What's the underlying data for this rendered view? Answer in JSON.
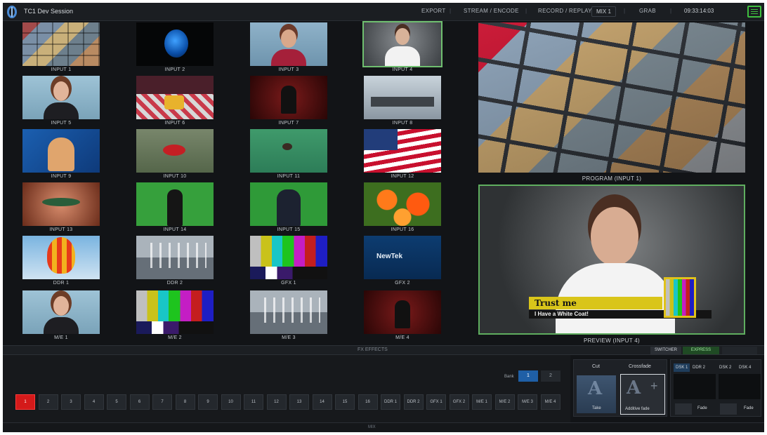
{
  "titlebar": {
    "session_name": "TC1 Dev Session",
    "menu": [
      "EXPORT",
      "STREAM / ENCODE",
      "RECORD / REPLAY",
      "GRAB"
    ],
    "mix_label": "MIX 1",
    "time": "09:33:14:03"
  },
  "inputs": [
    {
      "label": "INPUT 1"
    },
    {
      "label": "INPUT 2"
    },
    {
      "label": "INPUT 3"
    },
    {
      "label": "INPUT 4"
    },
    {
      "label": "INPUT 5"
    },
    {
      "label": "INPUT 6"
    },
    {
      "label": "INPUT 7"
    },
    {
      "label": "INPUT 8"
    },
    {
      "label": "INPUT 9"
    },
    {
      "label": "INPUT 10"
    },
    {
      "label": "INPUT 11"
    },
    {
      "label": "INPUT 12"
    },
    {
      "label": "INPUT 13"
    },
    {
      "label": "INPUT 14"
    },
    {
      "label": "INPUT 15"
    },
    {
      "label": "INPUT 16"
    },
    {
      "label": "DDR 1"
    },
    {
      "label": "DDR 2"
    },
    {
      "label": "GFX 1"
    },
    {
      "label": "GFX 2"
    },
    {
      "label": "M/E 1"
    },
    {
      "label": "M/E 2"
    },
    {
      "label": "M/E 3"
    },
    {
      "label": "M/E 4"
    }
  ],
  "gfx2_logo_text": "NewTek",
  "program": {
    "label": "PROGRAM (INPUT 1)"
  },
  "preview": {
    "label": "PREVIEW (INPUT 4)",
    "lower_third_title": "Trust me",
    "lower_third_subtitle": "I Have a White Coat!"
  },
  "effects": {
    "title": "FX EFFECTS",
    "switch_label": "SWITCHER",
    "express_label": "EXPRESS"
  },
  "switcher": {
    "bank_label": "Bank",
    "banks": [
      "1",
      "2"
    ],
    "buttons": [
      "1",
      "2",
      "3",
      "4",
      "5",
      "6",
      "7",
      "8",
      "9",
      "10",
      "11",
      "12",
      "13",
      "14",
      "15",
      "16",
      "DDR 1",
      "DDR 2",
      "GFX 1",
      "GFX 2",
      "M/E 1",
      "M/E 2",
      "M/E 3",
      "M/E 4"
    ],
    "active_index": 0
  },
  "transition": {
    "cut_label": "Cut",
    "crossfade_label": "Crossfade",
    "take_label": "Take",
    "auto_label": "Additive fade"
  },
  "dsk": {
    "tabs": [
      "DSK 1",
      "DDR 2",
      "DSK 2",
      "DSK 4"
    ],
    "fade_labels": [
      "Fade",
      "Fade"
    ]
  },
  "status": {
    "text": "MIX"
  }
}
